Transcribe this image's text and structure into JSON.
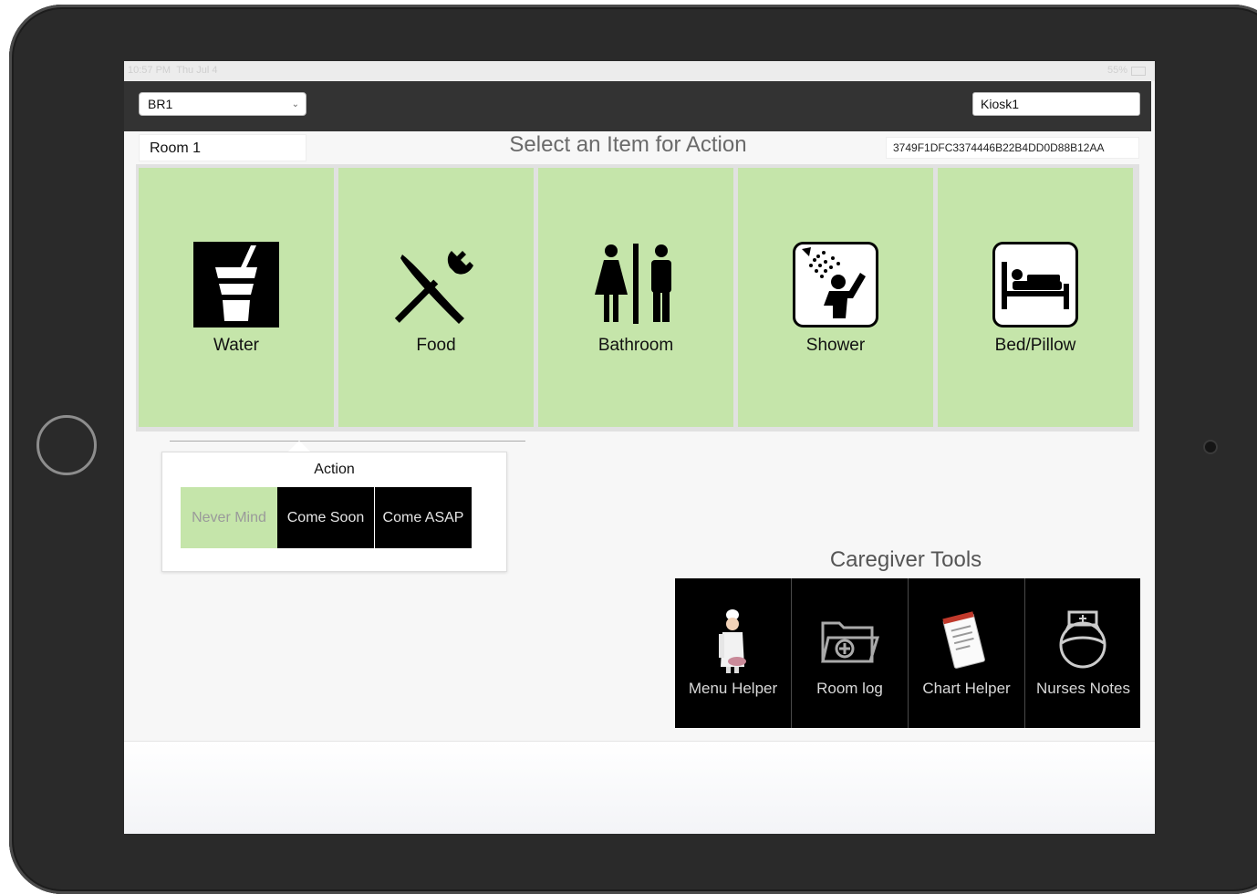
{
  "status": {
    "time": "10:57 PM",
    "date": "Thu Jul 4",
    "battery": "55%"
  },
  "header": {
    "location_select": "BR1",
    "kiosk": "Kiosk1"
  },
  "room": "Room 1",
  "title": "Select an Item for Action",
  "device_id": "3749F1DFC3374446B22B4DD0D88B12AA",
  "items": [
    {
      "label": "Water",
      "icon": "water-cup-icon"
    },
    {
      "label": "Food",
      "icon": "fork-knife-icon"
    },
    {
      "label": "Bathroom",
      "icon": "restroom-icon"
    },
    {
      "label": "Shower",
      "icon": "shower-icon"
    },
    {
      "label": "Bed/Pillow",
      "icon": "bed-icon"
    }
  ],
  "action_popup": {
    "title": "Action",
    "buttons": [
      "Never Mind",
      "Come Soon",
      "Come ASAP"
    ]
  },
  "caregiver": {
    "title": "Caregiver Tools",
    "tools": [
      {
        "label": "Menu Helper",
        "icon": "chef-icon"
      },
      {
        "label": "Room log",
        "icon": "folder-plus-icon"
      },
      {
        "label": "Chart Helper",
        "icon": "notepad-icon"
      },
      {
        "label": "Nurses Notes",
        "icon": "nurse-icon"
      }
    ]
  },
  "colors": {
    "tile_green": "#c5e5aa",
    "header_dark": "#333333",
    "tool_black": "#000000"
  }
}
